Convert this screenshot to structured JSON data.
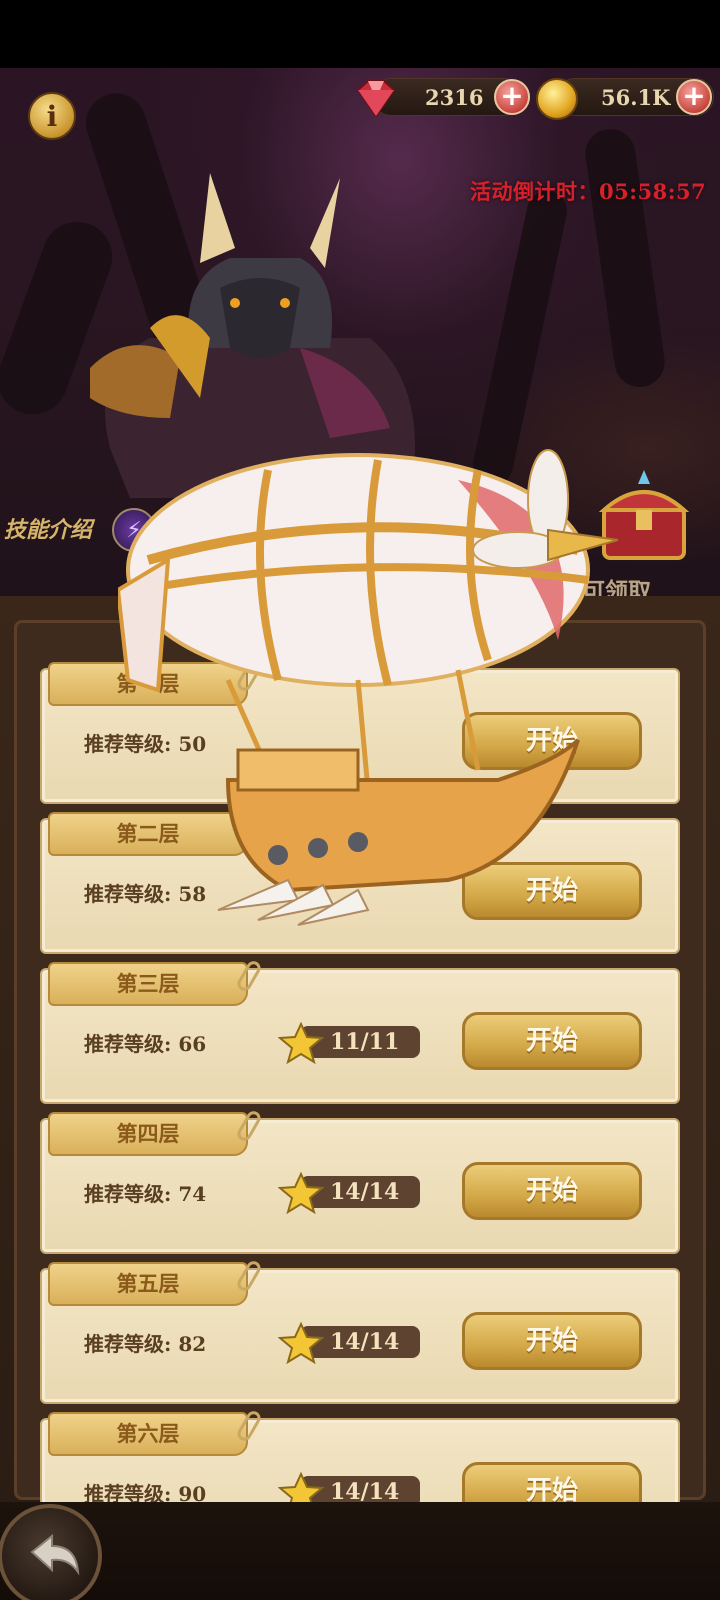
{
  "currency": {
    "gems": "2316",
    "coins": "56.1K",
    "gem_color": "#d0353e",
    "coin_color": "#e2a520"
  },
  "icons": {
    "info": "info-icon",
    "gem": "ruby-gem-icon",
    "coin": "gold-coin-icon",
    "add": "plus-icon",
    "skill": "lightning-skill-icon",
    "chest": "treasure-chest-icon",
    "back": "back-arrow-icon"
  },
  "event": {
    "countdown": "活动倒计时：05:58:57"
  },
  "skill": {
    "label": "技能介绍"
  },
  "reward": {
    "label": "可领取"
  },
  "levels": [
    {
      "name": "第一层",
      "recommend": "推荐等级: 50",
      "stars": "",
      "start": "开始"
    },
    {
      "name": "第二层",
      "recommend": "推荐等级: 58",
      "stars": "",
      "start": "开始"
    },
    {
      "name": "第三层",
      "recommend": "推荐等级: 66",
      "stars": "11/11",
      "start": "开始"
    },
    {
      "name": "第四层",
      "recommend": "推荐等级: 74",
      "stars": "14/14",
      "start": "开始"
    },
    {
      "name": "第五层",
      "recommend": "推荐等级: 82",
      "stars": "14/14",
      "start": "开始"
    },
    {
      "name": "第六层",
      "recommend": "推荐等级: 90",
      "stars": "14/14",
      "start": "开始"
    }
  ]
}
